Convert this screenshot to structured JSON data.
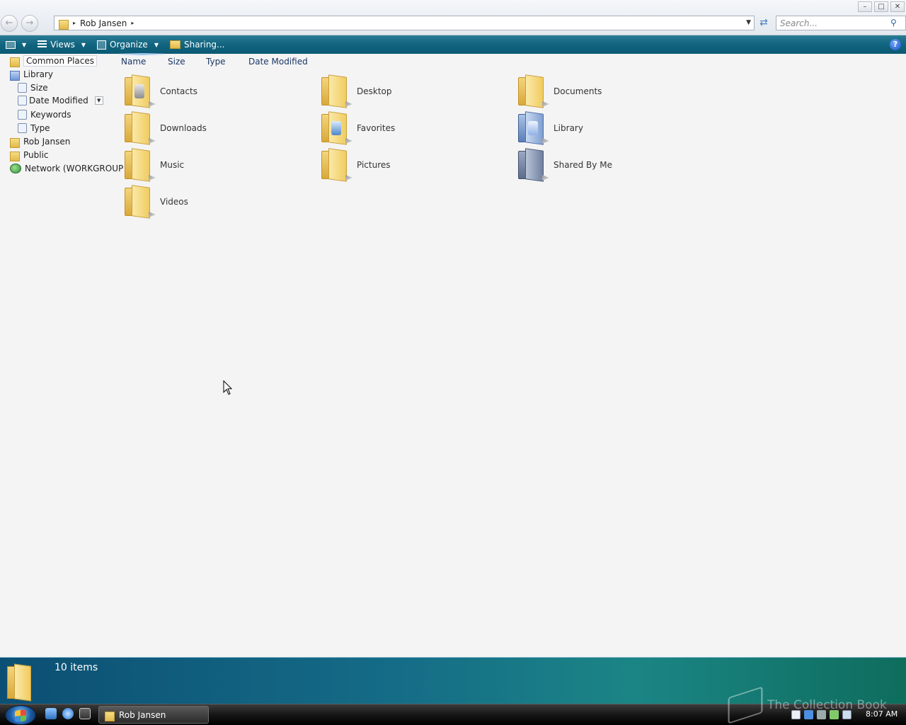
{
  "window": {
    "controls": {
      "minimize": "–",
      "maximize": "□",
      "close": "✕"
    },
    "nav": {
      "back_glyph": "←",
      "forward_glyph": "→"
    }
  },
  "address": {
    "breadcrumbs": [
      "Rob Jansen"
    ],
    "separator": "▸",
    "dropdown_glyph": "▼",
    "refresh_glyph": "⇄"
  },
  "search": {
    "placeholder": "Search...",
    "icon": "magnifier-icon"
  },
  "toolbar": {
    "layout_drop": "▼",
    "views_label": "Views",
    "organize_label": "Organize",
    "sharing_label": "Sharing...",
    "drop_glyph": "▼",
    "help_label": "?"
  },
  "navpane": {
    "items": [
      {
        "label": "Common Places",
        "icon": "folder-icon",
        "selected": true
      },
      {
        "label": "Library",
        "icon": "library-icon"
      },
      {
        "label": "Size",
        "icon": "search-folder-icon"
      },
      {
        "label": "Date Modified",
        "icon": "search-folder-icon",
        "dropdown": "▼"
      },
      {
        "label": "Keywords",
        "icon": "search-folder-icon"
      },
      {
        "label": "Type",
        "icon": "search-folder-icon"
      },
      {
        "label": "Rob Jansen",
        "icon": "folder-icon"
      },
      {
        "label": "Public",
        "icon": "folder-icon"
      },
      {
        "label": "Network (WORKGROUP",
        "icon": "network-icon"
      }
    ]
  },
  "columns": [
    "Name",
    "Size",
    "Type",
    "Date Modified"
  ],
  "items": [
    {
      "name": "Contacts",
      "icon": "contacts-folder-icon",
      "style": "yellow"
    },
    {
      "name": "Desktop",
      "icon": "desktop-folder-icon",
      "style": "yellow"
    },
    {
      "name": "Documents",
      "icon": "documents-folder-icon",
      "style": "yellow"
    },
    {
      "name": "Downloads",
      "icon": "downloads-folder-icon",
      "style": "yellow"
    },
    {
      "name": "Favorites",
      "icon": "favorites-folder-icon",
      "style": "yellow"
    },
    {
      "name": "Library",
      "icon": "library-folder-icon",
      "style": "blue"
    },
    {
      "name": "Music",
      "icon": "music-folder-icon",
      "style": "yellow"
    },
    {
      "name": "Pictures",
      "icon": "pictures-folder-icon",
      "style": "yellow"
    },
    {
      "name": "Shared By Me",
      "icon": "shared-folder-icon",
      "style": "slate"
    },
    {
      "name": "Videos",
      "icon": "videos-folder-icon",
      "style": "yellow"
    }
  ],
  "status": {
    "count": "10 items"
  },
  "taskbar": {
    "task_label": "Rob Jansen",
    "clock": "8:07 AM",
    "watermark": "The Collection Book"
  },
  "colors": {
    "accent": "#11647f",
    "taskbar": "#161616",
    "folder": "#f0cc61"
  }
}
